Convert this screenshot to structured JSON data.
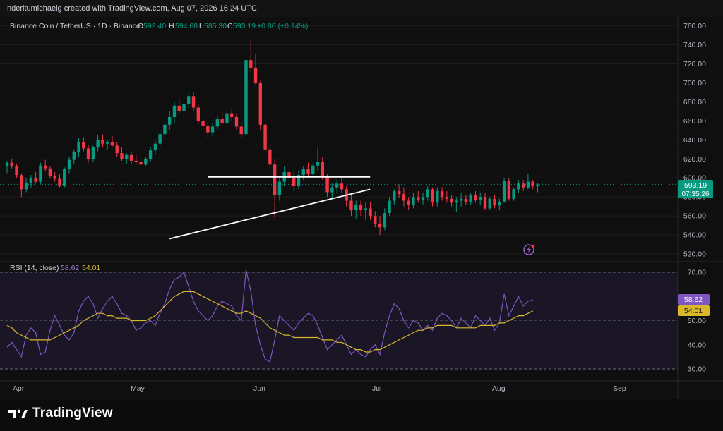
{
  "watermark": "nderitumichaelg created with TradingView.com, Aug 07, 2026 16:24 UTC",
  "legend": {
    "symbol": "Binance Coin / TetherUS · 1D · Binance",
    "o_label": "O",
    "o_value": "592.40",
    "h_label": "H",
    "h_value": "594.68",
    "l_label": "L",
    "l_value": "585.30",
    "c_label": "C",
    "c_value": "593.19",
    "change": "+0.80 (+0.14%)"
  },
  "rsi_legend": {
    "name": "RSI (14, close)",
    "rsi": "58.62",
    "ma": "54.01"
  },
  "price_label": {
    "price": "593.19",
    "countdown": "07:35:26"
  },
  "rsi_labels": {
    "rsi": "58.62",
    "ma": "54.01"
  },
  "brand": "TradingView",
  "colors": {
    "up": "#089981",
    "down": "#f23645",
    "rsi": "#7e57c2",
    "rsi_ma": "#d9b82a",
    "price_tag": "#089981"
  },
  "icons": {
    "logo": "tradingview-logo-icon",
    "lightning": "lightning-icon"
  },
  "chart_data": [
    {
      "type": "candlestick",
      "title": "",
      "x_ticks": [
        "Apr",
        "May",
        "Jun",
        "Jul",
        "Aug",
        "Sep"
      ],
      "y_ticks": [
        "760.00",
        "740.00",
        "720.00",
        "700.00",
        "680.00",
        "660.00",
        "640.00",
        "620.00",
        "600.00",
        "580.00",
        "560.00",
        "540.00",
        "520.00"
      ],
      "ylim": [
        513,
        772
      ],
      "candles": [
        [
          612,
          618,
          605,
          616
        ],
        [
          616,
          620,
          610,
          612
        ],
        [
          612,
          615,
          600,
          603
        ],
        [
          603,
          605,
          580,
          588
        ],
        [
          588,
          600,
          585,
          595
        ],
        [
          595,
          603,
          590,
          600
        ],
        [
          600,
          606,
          594,
          596
        ],
        [
          596,
          616,
          593,
          613
        ],
        [
          613,
          619,
          607,
          610
        ],
        [
          610,
          612,
          600,
          602
        ],
        [
          602,
          606,
          596,
          599
        ],
        [
          599,
          604,
          590,
          592
        ],
        [
          592,
          611,
          590,
          609
        ],
        [
          609,
          622,
          605,
          619
        ],
        [
          619,
          630,
          615,
          627
        ],
        [
          627,
          642,
          622,
          638
        ],
        [
          638,
          643,
          628,
          631
        ],
        [
          631,
          635,
          616,
          620
        ],
        [
          620,
          634,
          617,
          632
        ],
        [
          632,
          645,
          628,
          640
        ],
        [
          640,
          646,
          632,
          636
        ],
        [
          636,
          640,
          630,
          638
        ],
        [
          638,
          644,
          632,
          634
        ],
        [
          634,
          638,
          622,
          626
        ],
        [
          626,
          632,
          618,
          620
        ],
        [
          620,
          626,
          615,
          624
        ],
        [
          624,
          628,
          614,
          618
        ],
        [
          618,
          624,
          614,
          617
        ],
        [
          617,
          622,
          612,
          614
        ],
        [
          614,
          622,
          612,
          620
        ],
        [
          620,
          632,
          617,
          629
        ],
        [
          629,
          640,
          624,
          636
        ],
        [
          636,
          650,
          632,
          646
        ],
        [
          646,
          660,
          642,
          656
        ],
        [
          656,
          670,
          650,
          664
        ],
        [
          664,
          680,
          658,
          676
        ],
        [
          676,
          684,
          668,
          670
        ],
        [
          670,
          682,
          665,
          678
        ],
        [
          678,
          690,
          674,
          686
        ],
        [
          686,
          690,
          670,
          674
        ],
        [
          674,
          678,
          656,
          660
        ],
        [
          660,
          666,
          650,
          655
        ],
        [
          655,
          660,
          642,
          648
        ],
        [
          648,
          658,
          644,
          654
        ],
        [
          654,
          666,
          650,
          662
        ],
        [
          662,
          670,
          654,
          658
        ],
        [
          658,
          672,
          656,
          668
        ],
        [
          668,
          673,
          660,
          664
        ],
        [
          664,
          668,
          650,
          654
        ],
        [
          654,
          660,
          642,
          646
        ],
        [
          646,
          726,
          644,
          724
        ],
        [
          724,
          745,
          710,
          716
        ],
        [
          716,
          730,
          698,
          700
        ],
        [
          700,
          702,
          650,
          656
        ],
        [
          656,
          660,
          625,
          630
        ],
        [
          630,
          636,
          610,
          614
        ],
        [
          614,
          620,
          558,
          582
        ],
        [
          582,
          600,
          576,
          596
        ],
        [
          596,
          612,
          592,
          606
        ],
        [
          606,
          610,
          594,
          600
        ],
        [
          600,
          606,
          586,
          592
        ],
        [
          592,
          608,
          588,
          603
        ],
        [
          603,
          612,
          598,
          609
        ],
        [
          609,
          616,
          601,
          604
        ],
        [
          604,
          616,
          601,
          613
        ],
        [
          613,
          632,
          607,
          617
        ],
        [
          617,
          622,
          598,
          601
        ],
        [
          601,
          604,
          580,
          585
        ],
        [
          585,
          594,
          579,
          590
        ],
        [
          590,
          598,
          584,
          594
        ],
        [
          594,
          600,
          584,
          588
        ],
        [
          588,
          592,
          570,
          576
        ],
        [
          576,
          582,
          560,
          566
        ],
        [
          566,
          576,
          557,
          572
        ],
        [
          572,
          576,
          560,
          566
        ],
        [
          566,
          574,
          556,
          568
        ],
        [
          568,
          575,
          556,
          560
        ],
        [
          560,
          565,
          548,
          552
        ],
        [
          552,
          560,
          540,
          548
        ],
        [
          548,
          568,
          545,
          563
        ],
        [
          563,
          580,
          560,
          576
        ],
        [
          576,
          588,
          572,
          586
        ],
        [
          586,
          593,
          579,
          583
        ],
        [
          583,
          590,
          570,
          576
        ],
        [
          576,
          580,
          566,
          572
        ],
        [
          572,
          584,
          568,
          580
        ],
        [
          580,
          586,
          574,
          577
        ],
        [
          577,
          584,
          572,
          580
        ],
        [
          580,
          592,
          576,
          588
        ],
        [
          588,
          590,
          570,
          574
        ],
        [
          574,
          590,
          570,
          586
        ],
        [
          586,
          590,
          576,
          580
        ],
        [
          580,
          586,
          574,
          578
        ],
        [
          578,
          582,
          570,
          574
        ],
        [
          574,
          580,
          564,
          576
        ],
        [
          576,
          584,
          570,
          578
        ],
        [
          578,
          582,
          572,
          575
        ],
        [
          575,
          584,
          572,
          582
        ],
        [
          582,
          586,
          574,
          577
        ],
        [
          577,
          584,
          572,
          580
        ],
        [
          580,
          584,
          566,
          568
        ],
        [
          568,
          580,
          566,
          578
        ],
        [
          578,
          582,
          568,
          571
        ],
        [
          571,
          578,
          566,
          575
        ],
        [
          575,
          600,
          574,
          597
        ],
        [
          597,
          600,
          576,
          578
        ],
        [
          578,
          590,
          576,
          588
        ],
        [
          588,
          598,
          584,
          594
        ],
        [
          594,
          598,
          586,
          590
        ],
        [
          590,
          604,
          588,
          596
        ],
        [
          596,
          598,
          588,
          592
        ],
        [
          592,
          595,
          585,
          593
        ]
      ],
      "trendlines": [
        {
          "name": "resistance",
          "from": [
            42,
            601
          ],
          "to": [
            73,
            601
          ]
        },
        {
          "name": "support",
          "from": [
            34,
            536
          ],
          "to": [
            73,
            588
          ]
        }
      ],
      "last_price": 593.19
    },
    {
      "type": "line",
      "title": "RSI (14, close)",
      "x_ticks": [
        "Apr",
        "May",
        "Jun",
        "Jul",
        "Aug",
        "Sep"
      ],
      "y_ticks": [
        "70.00",
        "50.00",
        "40.00",
        "30.00"
      ],
      "ylim": [
        28,
        72
      ],
      "bands": [
        30,
        50,
        70
      ],
      "series": [
        {
          "name": "RSI",
          "values": [
            39,
            41,
            38,
            35,
            44,
            47,
            45,
            36,
            37,
            46,
            52,
            48,
            44,
            42,
            45,
            54,
            58,
            60,
            57,
            51,
            55,
            58,
            60,
            57,
            53,
            52,
            50,
            46,
            47,
            49,
            50,
            48,
            53,
            57,
            63,
            67,
            68,
            70,
            64,
            58,
            54,
            52,
            50,
            52,
            56,
            58,
            57,
            56,
            52,
            50,
            71,
            62,
            48,
            40,
            34,
            33,
            42,
            52,
            50,
            48,
            46,
            49,
            51,
            53,
            52,
            48,
            43,
            38,
            40,
            42,
            44,
            40,
            36,
            38,
            36,
            35,
            38,
            40,
            36,
            45,
            52,
            57,
            55,
            50,
            47,
            50,
            49,
            46,
            48,
            46,
            51,
            53,
            52,
            50,
            47,
            51,
            49,
            47,
            52,
            50,
            48,
            51,
            46,
            49,
            61,
            52,
            56,
            60,
            56,
            58,
            58.62
          ]
        },
        {
          "name": "RSI MA",
          "values": [
            48,
            47,
            45,
            44,
            43,
            42,
            42,
            42,
            42,
            42,
            43,
            44,
            45,
            46,
            47,
            48,
            50,
            51,
            52,
            53,
            53,
            52,
            52,
            51,
            51,
            51,
            50,
            50,
            50,
            50,
            51,
            52,
            54,
            56,
            58,
            60,
            61,
            62,
            62,
            62,
            61,
            60,
            59,
            58,
            57,
            56,
            55,
            54,
            53,
            53,
            54,
            53,
            52,
            51,
            49,
            47,
            46,
            45,
            44,
            44,
            43,
            43,
            43,
            43,
            43,
            43,
            42,
            42,
            42,
            41,
            41,
            40,
            39,
            38,
            38,
            37,
            37,
            38,
            38,
            39,
            40,
            41,
            42,
            43,
            44,
            45,
            46,
            46,
            47,
            47,
            48,
            48,
            48,
            48,
            47,
            47,
            47,
            47,
            47,
            48,
            48,
            48,
            48,
            49,
            49,
            50,
            51,
            52,
            52,
            53,
            54.01
          ]
        }
      ]
    }
  ]
}
